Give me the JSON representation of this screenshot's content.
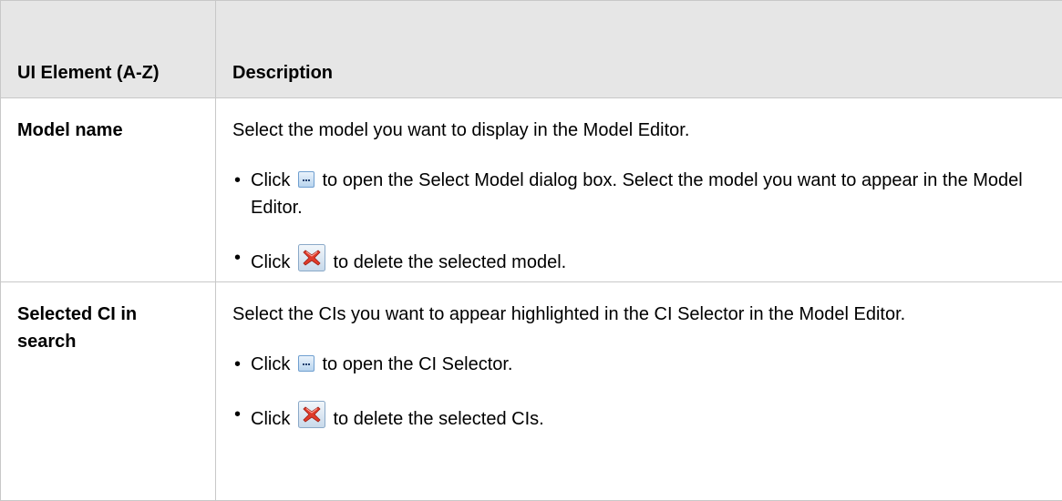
{
  "table": {
    "headers": [
      "UI Element (A-Z)",
      "Description"
    ],
    "rows": [
      {
        "element": "Model name",
        "intro": "Select the model you want to display in the Model Editor.",
        "bullets": [
          {
            "prefix": "Click",
            "icon": "ellipsis-button-icon",
            "text": "to open the Select Model dialog box. Select the model you want to appear in the Model Editor."
          },
          {
            "prefix": "Click",
            "icon": "delete-x-icon",
            "text": "to delete the selected model."
          }
        ]
      },
      {
        "element": "Selected CI in search",
        "intro": "Select the CIs you want to appear highlighted in the CI Selector in the Model Editor.",
        "bullets": [
          {
            "prefix": "Click",
            "icon": "ellipsis-button-icon",
            "text": "to open the CI Selector."
          },
          {
            "prefix": "Click",
            "icon": "delete-x-icon",
            "text": "to delete the selected CIs."
          }
        ]
      }
    ]
  },
  "colors": {
    "header_bg": "#e6e6e6",
    "border": "#c8c8c8",
    "delete_icon_red": "#e03b2a"
  }
}
